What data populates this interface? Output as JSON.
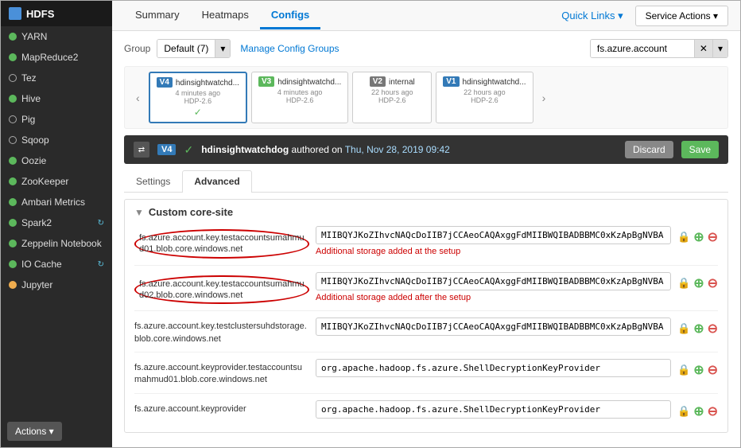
{
  "sidebar": {
    "header": "HDFS",
    "items": [
      {
        "label": "YARN",
        "status": "green"
      },
      {
        "label": "MapReduce2",
        "status": "green"
      },
      {
        "label": "Tez",
        "status": "monitor"
      },
      {
        "label": "Hive",
        "status": "green"
      },
      {
        "label": "Pig",
        "status": "monitor"
      },
      {
        "label": "Sqoop",
        "status": "monitor"
      },
      {
        "label": "Oozie",
        "status": "green"
      },
      {
        "label": "ZooKeeper",
        "status": "green"
      },
      {
        "label": "Ambari Metrics",
        "status": "green"
      },
      {
        "label": "Spark2",
        "status": "green",
        "refresh": true
      },
      {
        "label": "Zeppelin Notebook",
        "status": "green"
      },
      {
        "label": "IO Cache",
        "status": "green",
        "refresh": true
      },
      {
        "label": "Jupyter",
        "status": "yellow"
      }
    ],
    "actions_label": "Actions ▾"
  },
  "top_nav": {
    "tabs": [
      "Summary",
      "Heatmaps",
      "Configs"
    ],
    "active_tab": "Configs",
    "quick_links": "Quick Links ▾",
    "service_actions": "Service Actions ▾"
  },
  "group_bar": {
    "label": "Group",
    "group_value": "Default (7)",
    "manage_link": "Manage Config Groups",
    "search_value": "fs.azure.account"
  },
  "versions": [
    {
      "badge": "V4",
      "badge_class": "v4",
      "name": "hdinsightwatchd...",
      "time": "4 minutes ago",
      "hdp": "HDP-2.6",
      "selected": true
    },
    {
      "badge": "V3",
      "badge_class": "v3",
      "name": "hdinsightwatchd...",
      "time": "4 minutes ago",
      "hdp": "HDP-2.6",
      "selected": false
    },
    {
      "badge": "V2",
      "badge_class": "v2",
      "name": "internal",
      "time": "22 hours ago",
      "hdp": "HDP-2.6",
      "selected": false
    },
    {
      "badge": "V1",
      "badge_class": "v1",
      "name": "hdinsightwatchd...",
      "time": "22 hours ago",
      "hdp": "HDP-2.6",
      "selected": false
    }
  ],
  "commit_bar": {
    "version": "V4",
    "author": "hdinsightwatchdog",
    "action": "authored on",
    "date": "Thu, Nov 28, 2019 09:42",
    "discard": "Discard",
    "save": "Save"
  },
  "settings_tabs": [
    "Settings",
    "Advanced"
  ],
  "active_settings_tab": "Advanced",
  "section": {
    "title": "Custom core-site"
  },
  "config_rows": [
    {
      "key": "fs.azure.account.key.testaccountsumahmud01.blob.core.windows.net",
      "value": "MIIBQYJKoZIhvcNAQcDoIIB7jCCAeoCAQAxggFdMIIBWQIBADBBMC0xKzApBgNVBA...",
      "note": "Additional storage added at the setup",
      "highlighted": true
    },
    {
      "key": "fs.azure.account.key.testaccountsumahmud02.blob.core.windows.net",
      "value": "MIIBQYJKoZIhvcNAQcDoIIB7jCCAeoCAQAxggFdMIIBWQIBADBBMC0xKzApBgNVBA...",
      "note": "Additional storage added after the setup",
      "highlighted": true
    },
    {
      "key": "fs.azure.account.key.testclustersuhdstorage.blob.core.windows.net",
      "value": "MIIBQYJKoZIhvcNAQcDoIIB7jCCAeoCAQAxggFdMIIBWQIBADBBMC0xKzApBgNVBA...",
      "note": "",
      "highlighted": false
    },
    {
      "key": "fs.azure.account.keyprovider.testaccountsumahmud01.blob.core.windows.net",
      "value": "org.apache.hadoop.fs.azure.ShellDecryptionKeyProvider",
      "note": "",
      "highlighted": false
    },
    {
      "key": "fs.azure.account.keyprovider",
      "value": "org.apache.hadoop.fs.azure.ShellDecryptionKeyProvider",
      "note": "",
      "highlighted": false
    }
  ],
  "icons": {
    "lock": "🔒",
    "plus": "●",
    "minus": "●",
    "checkmark": "✓",
    "arrow_left": "‹",
    "arrow_right": "›",
    "arrow_down": "▾",
    "arrow_right_section": "▼"
  }
}
